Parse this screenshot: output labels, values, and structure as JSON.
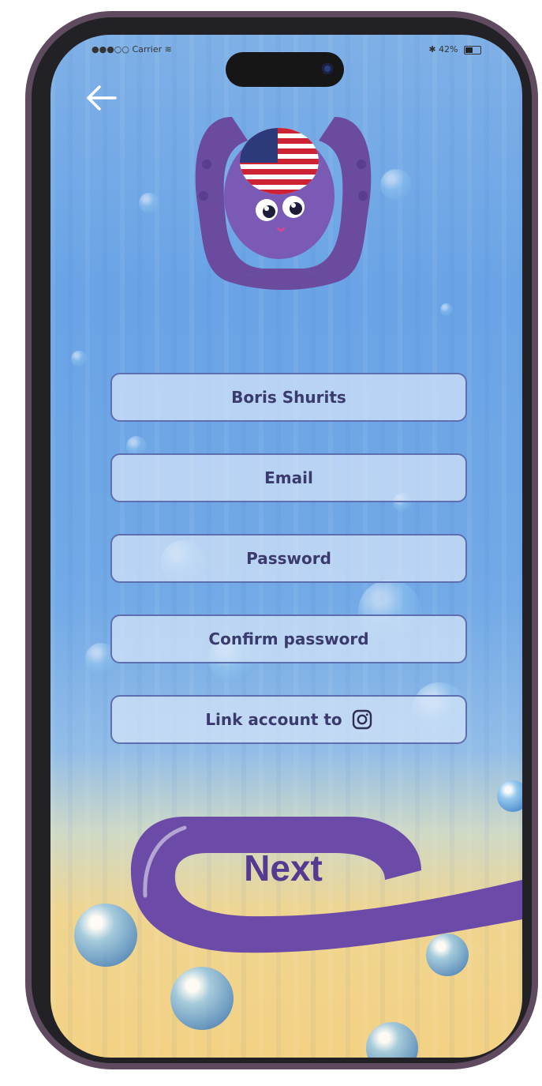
{
  "status_bar": {
    "carrier": "Carrier",
    "battery_text": "42%"
  },
  "icons": {
    "back": "arrow-left-icon",
    "logo": "octopus-flag-logo",
    "instagram": "instagram-icon"
  },
  "form": {
    "name_value": "Boris Shurits",
    "email_placeholder": "Email",
    "password_placeholder": "Password",
    "confirm_placeholder": "Confirm password",
    "link_account_label": "Link account to"
  },
  "actions": {
    "next_label": "Next"
  },
  "colors": {
    "brand_purple": "#6b4aa8",
    "text_dark": "#3a3a6e",
    "field_border": "#5e6fb0"
  }
}
